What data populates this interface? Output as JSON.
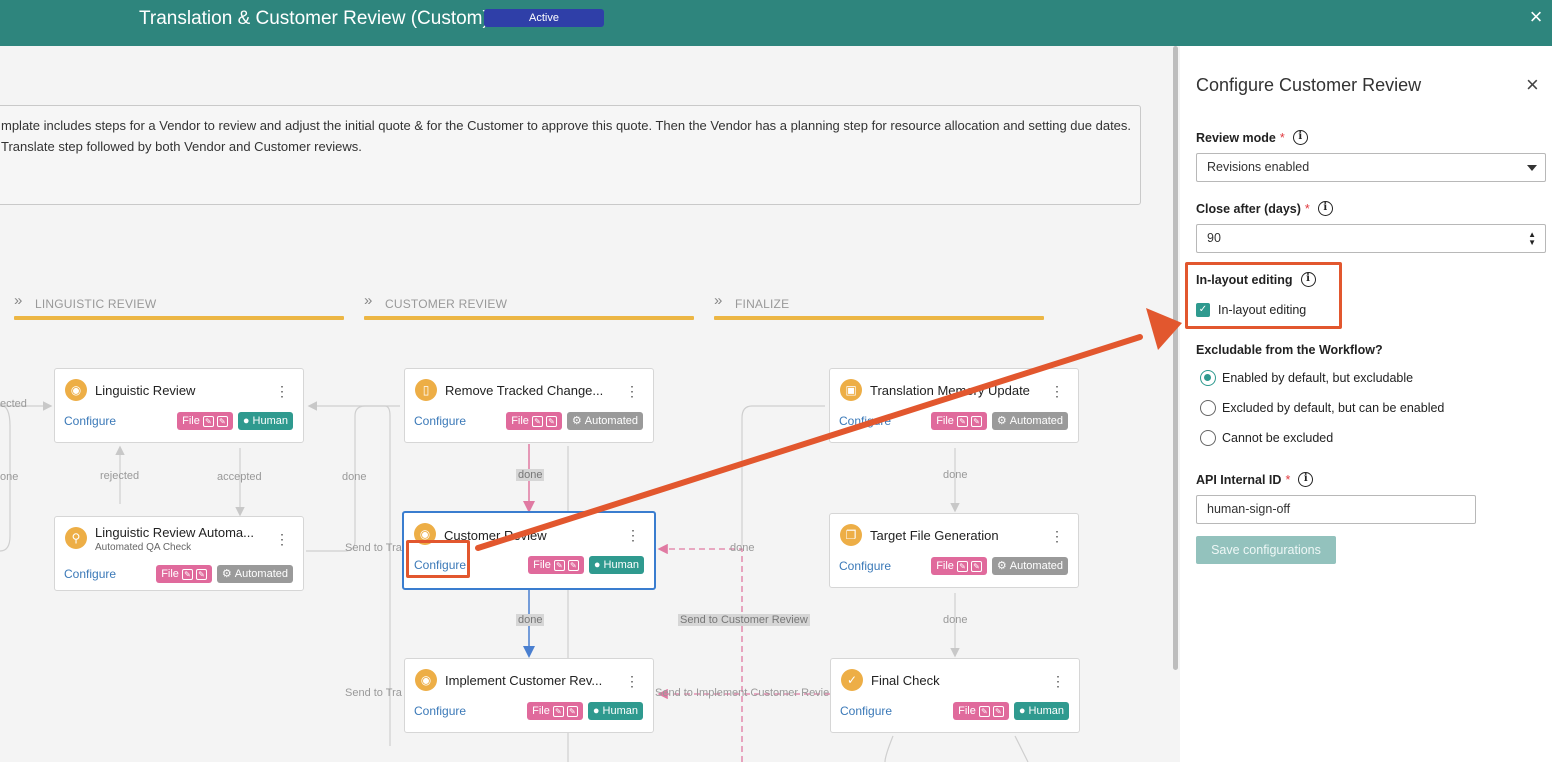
{
  "header": {
    "title": "Translation & Customer Review (Custom)",
    "status_badge": "Active",
    "close_icon": "×"
  },
  "description": {
    "line1": "mplate includes steps for a Vendor to review and adjust the initial quote & for the Customer to approve this quote. Then the Vendor has a planning step for resource allocation and setting due dates.",
    "line2": "Translate step followed by both Vendor and Customer reviews."
  },
  "stages": [
    {
      "label": "LINGUISTIC REVIEW",
      "icon": "double-chevron-icon"
    },
    {
      "label": "CUSTOMER REVIEW",
      "icon": "double-chevron-icon"
    },
    {
      "label": "FINALIZE",
      "icon": "double-chevron-icon"
    }
  ],
  "nodes": {
    "linguistic_review": {
      "title": "Linguistic Review",
      "configure": "Configure",
      "file": "File",
      "type": "Human",
      "icon": "eye-icon"
    },
    "lr_automated": {
      "title": "Linguistic Review Automa...",
      "subtitle": "Automated QA Check",
      "configure": "Configure",
      "file": "File",
      "type": "Automated",
      "icon": "search-icon"
    },
    "remove_tracked": {
      "title": "Remove Tracked Change...",
      "configure": "Configure",
      "file": "File",
      "type": "Automated",
      "icon": "document-icon"
    },
    "customer_review": {
      "title": "Customer Review",
      "configure": "Configure",
      "file": "File",
      "type": "Human",
      "icon": "eye-icon"
    },
    "implement_review": {
      "title": "Implement Customer Rev...",
      "configure": "Configure",
      "file": "File",
      "type": "Human",
      "icon": "eye-icon"
    },
    "tm_update": {
      "title": "Translation Memory Update",
      "configure": "Configure",
      "file": "File",
      "type": "Automated",
      "icon": "database-icon"
    },
    "target_file": {
      "title": "Target File Generation",
      "configure": "Configure",
      "file": "File",
      "type": "Automated",
      "icon": "copy-icon"
    },
    "final_check": {
      "title": "Final Check",
      "configure": "Configure",
      "file": "File",
      "type": "Human",
      "icon": "check-icon"
    }
  },
  "edge_labels": {
    "rejected_left": "ected",
    "done_left": "one",
    "rejected": "rejected",
    "accepted": "accepted",
    "done_1": "done",
    "send_to_tra_1": "Send to Tra",
    "done_remove": "done",
    "done_customer": "done",
    "done_cr_back": "done",
    "send_to_customer_review": "Send to Customer Review",
    "send_to_implement": "Send to Implement Customer Revie",
    "send_to_tra_2": "Send to Tra",
    "done_tm": "done",
    "done_target": "done"
  },
  "panel": {
    "title": "Configure Customer Review",
    "close_icon": "×",
    "review_mode_label": "Review mode",
    "review_mode_value": "Revisions enabled",
    "close_after_label": "Close after (days)",
    "close_after_value": "90",
    "inlayout_label": "In-layout editing",
    "inlayout_checkbox_label": "In-layout editing",
    "excludable_label": "Excludable from the Workflow?",
    "radio_options": [
      "Enabled by default, but excludable",
      "Excluded by default, but can be enabled",
      "Cannot be excluded"
    ],
    "api_id_label": "API Internal ID",
    "api_id_value": "human-sign-off",
    "save_button": "Save configurations",
    "required_marker": "*"
  },
  "colors": {
    "header": "#2e857d",
    "badge": "#2f3fa8",
    "stage_bar": "#ecb644",
    "file_tag": "#e06a9c",
    "human_tag": "#2f9a8f",
    "automated_tag": "#9a9a9a",
    "highlight": "#e2572e",
    "selected_border": "#3a7dcf"
  }
}
